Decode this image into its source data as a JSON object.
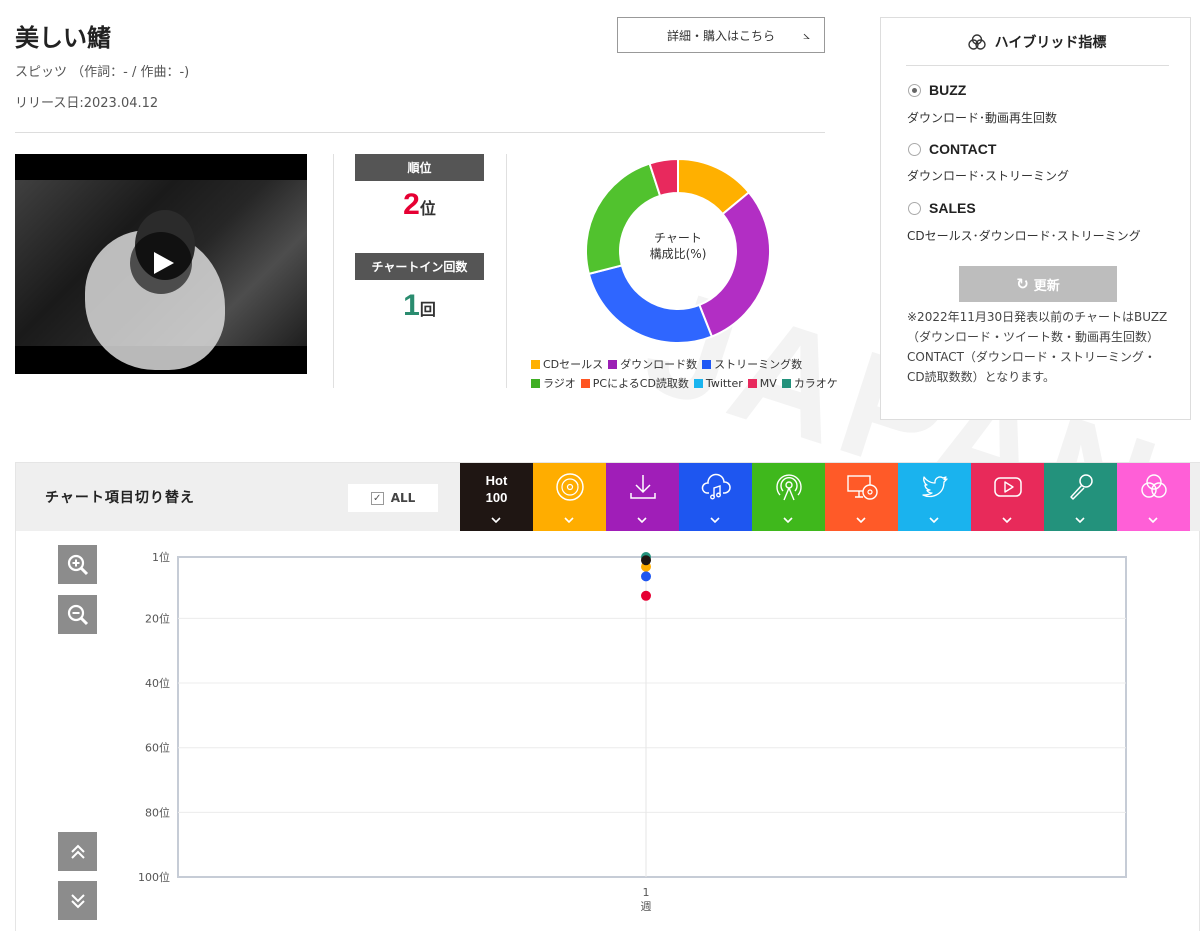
{
  "song": {
    "title": "美しい鰭",
    "artist_line": "スピッツ （作詞：- / 作曲：-)",
    "release": "リリース日:2023.04.12",
    "detail_button": "詳細・購入はこちら"
  },
  "stats": {
    "rank_label": "順位",
    "rank_value": "2",
    "rank_unit": "位",
    "chartin_label": "チャートイン回数",
    "chartin_value": "1",
    "chartin_unit": "回"
  },
  "donut": {
    "center_line1": "チャート",
    "center_line2": "構成比(%)",
    "segments": [
      {
        "name": "CDセールス",
        "value": 14,
        "color": "#ffb000"
      },
      {
        "name": "ダウンロード数",
        "value": 30,
        "color": "#b22ec4"
      },
      {
        "name": "ストリーミング数",
        "value": 27,
        "color": "#2f66ff"
      },
      {
        "name": "ラジオ",
        "value": 24,
        "color": "#51c22e"
      },
      {
        "name": "MV",
        "value": 5,
        "color": "#e8295d"
      }
    ],
    "legend_row1": [
      {
        "label": "CDセールス",
        "color": "#ffb000"
      },
      {
        "label": "ダウンロード数",
        "color": "#9b1fb5"
      },
      {
        "label": "ストリーミング数",
        "color": "#1e57f5"
      }
    ],
    "legend_row2": [
      {
        "label": "ラジオ",
        "color": "#3fae23"
      },
      {
        "label": "PCによるCD読取数",
        "color": "#ff5522"
      },
      {
        "label": "Twitter",
        "color": "#19b4ef"
      },
      {
        "label": "MV",
        "color": "#e8295d"
      },
      {
        "label": "カラオケ",
        "color": "#23927c"
      }
    ]
  },
  "hybrid": {
    "title": "ハイブリッド指標",
    "options": [
      {
        "label": "BUZZ",
        "desc": "ダウンロード･動画再生回数",
        "selected": true
      },
      {
        "label": "CONTACT",
        "desc": "ダウンロード･ストリーミング",
        "selected": false
      },
      {
        "label": "SALES",
        "desc": "CDセールス･ダウンロード･ストリーミング",
        "selected": false
      }
    ],
    "update_button": "更新",
    "note": "※2022年11月30日発表以前のチャートはBUZZ（ダウンロード・ツイート数・動画再生回数）CONTACT（ダウンロード・ストリーミング・CD読取数数）となります。"
  },
  "chart_switch": {
    "title": "チャート項目切り替え",
    "all_label": "ALL",
    "hot_line1": "Hot",
    "hot_line2": "100",
    "tabs": [
      {
        "icon": "hot100",
        "color": "#1f1613"
      },
      {
        "icon": "cd-icon",
        "color": "#ffad00"
      },
      {
        "icon": "download-icon",
        "color": "#a01eb8"
      },
      {
        "icon": "streaming-icon",
        "color": "#1e56f0"
      },
      {
        "icon": "radio-icon",
        "color": "#3fb81c"
      },
      {
        "icon": "pc-cd-icon",
        "color": "#ff5a28"
      },
      {
        "icon": "twitter-icon",
        "color": "#1ab3ee"
      },
      {
        "icon": "youtube-icon",
        "color": "#e82a5a"
      },
      {
        "icon": "karaoke-icon",
        "color": "#23927c"
      },
      {
        "icon": "hybrid-icon",
        "color": "#ff5fd7"
      }
    ]
  },
  "chart_data": {
    "type": "scatter",
    "title": "",
    "y_reversed": true,
    "ylim": [
      1,
      100
    ],
    "y_ticks": [
      {
        "value": 1,
        "label": "1位"
      },
      {
        "value": 20,
        "label": "20位"
      },
      {
        "value": 40,
        "label": "40位"
      },
      {
        "value": 60,
        "label": "60位"
      },
      {
        "value": 80,
        "label": "80位"
      },
      {
        "value": 100,
        "label": "100位"
      }
    ],
    "x_tick_line1": "1",
    "x_tick_line2": "週",
    "points": [
      {
        "week": 1,
        "rank": 1,
        "color": "#23927c"
      },
      {
        "week": 1,
        "rank": 4,
        "color": "#ffad00"
      },
      {
        "week": 1,
        "rank": 7,
        "color": "#1e56f0"
      },
      {
        "week": 1,
        "rank": 2,
        "color": "#1f1613"
      },
      {
        "week": 1,
        "rank": 13,
        "color": "#e60033"
      }
    ]
  }
}
